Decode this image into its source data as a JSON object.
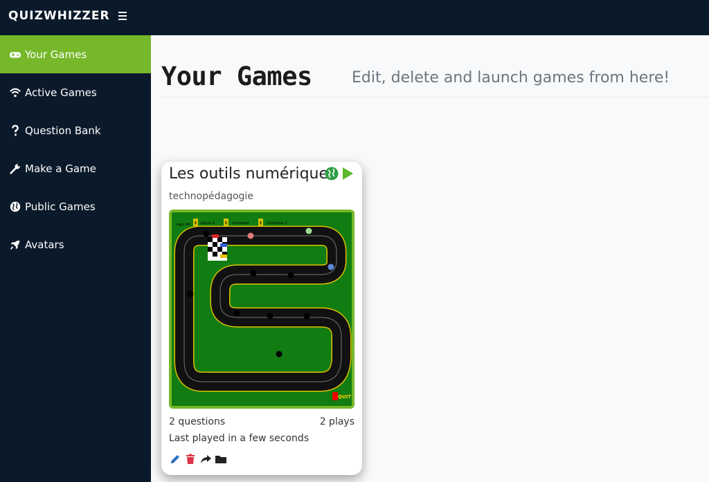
{
  "header": {
    "brand": "QUIZWHIZZER"
  },
  "sidebar": {
    "items": [
      {
        "label": "Your Games",
        "icon": "gamepad-icon",
        "active": true
      },
      {
        "label": "Active Games",
        "icon": "wifi-icon"
      },
      {
        "label": "Question Bank",
        "icon": "question-icon"
      },
      {
        "label": "Make a Game",
        "icon": "wrench-icon"
      },
      {
        "label": "Public Games",
        "icon": "globe-icon"
      },
      {
        "label": "Avatars",
        "icon": "rocket-icon"
      }
    ]
  },
  "main": {
    "title": "Your Games",
    "subtitle": "Edit, delete and launch games from here!",
    "cards": [
      {
        "title": "Les outils numériques",
        "subject": "technopédagogie",
        "questions": "2 questions",
        "plays": "2 plays",
        "last_played": "Last played in a few seconds",
        "thumbnail_labels": [
          "Laps left",
          "$",
          "player 1",
          "$",
          "Computer",
          "$",
          "Computer 2",
          "QUIT"
        ]
      }
    ]
  },
  "colors": {
    "accent": "#76b82a",
    "nav_bg": "#0b1a2a",
    "edit": "#2a72c8",
    "delete": "#dc3545",
    "track_bg": "#117c11"
  }
}
